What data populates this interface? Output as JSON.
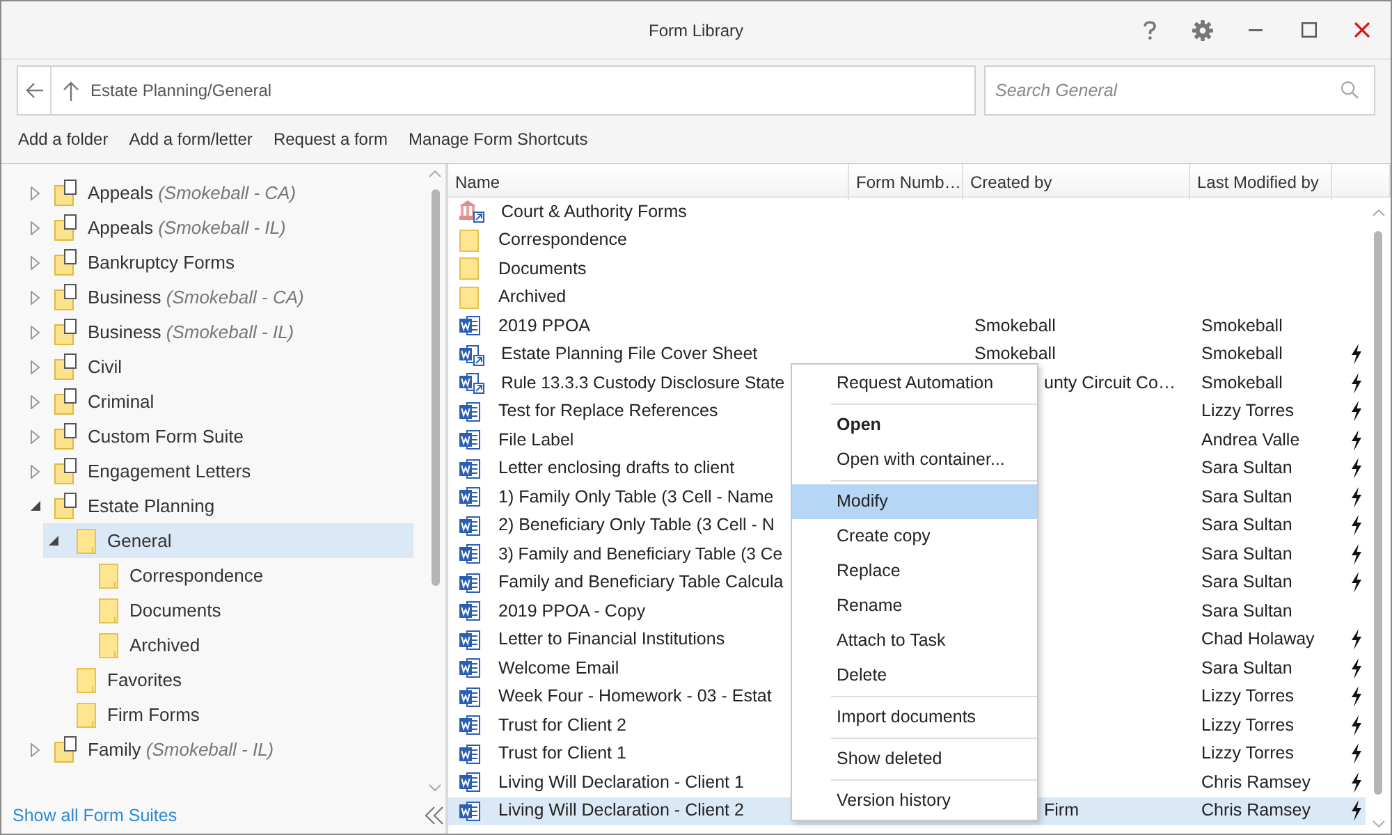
{
  "window": {
    "title": "Form Library"
  },
  "address": {
    "path": "Estate Planning/General"
  },
  "search": {
    "placeholder": "Search General"
  },
  "toolbar": [
    "Add a folder",
    "Add a form/letter",
    "Request a form",
    "Manage Form Shortcuts"
  ],
  "tree": [
    {
      "label": "Appeals *(Smokeball - CA)*",
      "kind": "suite",
      "expanded": false,
      "selected": false
    },
    {
      "label": "Appeals *(Smokeball - IL)*",
      "kind": "suite",
      "expanded": false,
      "selected": false
    },
    {
      "label": "Bankruptcy Forms",
      "kind": "suite",
      "expanded": false,
      "selected": false
    },
    {
      "label": "Business *(Smokeball - CA)*",
      "kind": "suite",
      "expanded": false,
      "selected": false
    },
    {
      "label": "Business *(Smokeball - IL)*",
      "kind": "suite",
      "expanded": false,
      "selected": false
    },
    {
      "label": "Civil",
      "kind": "suite",
      "expanded": false,
      "selected": false
    },
    {
      "label": "Criminal",
      "kind": "suite",
      "expanded": false,
      "selected": false
    },
    {
      "label": "Custom Form Suite",
      "kind": "suite",
      "expanded": false,
      "selected": false
    },
    {
      "label": "Engagement Letters",
      "kind": "suite",
      "expanded": false,
      "selected": false
    },
    {
      "label": "Estate Planning",
      "kind": "suite",
      "expanded": true,
      "selected": false,
      "children": [
        {
          "label": "General",
          "kind": "folder",
          "expanded": true,
          "selected": true,
          "children": [
            {
              "label": "Correspondence",
              "kind": "folder",
              "selected": false
            },
            {
              "label": "Documents",
              "kind": "folder",
              "selected": false
            },
            {
              "label": "Archived",
              "kind": "folder",
              "selected": false
            }
          ]
        },
        {
          "label": "Favorites",
          "kind": "folder",
          "selected": false
        },
        {
          "label": "Firm Forms",
          "kind": "folder",
          "selected": false
        }
      ]
    },
    {
      "label": "Family *(Smokeball - IL)*",
      "kind": "suite",
      "expanded": false,
      "selected": false
    }
  ],
  "show_all_link": "Show all Form Suites",
  "table": {
    "columns": [
      "Name",
      "Form Numb…",
      "Created by",
      "Last Modified by"
    ],
    "rows": [
      {
        "kind": "court-shortcut",
        "name": "Court & Authority Forms",
        "automated": false,
        "selected": false
      },
      {
        "kind": "folder",
        "name": "Correspondence",
        "automated": false,
        "selected": false
      },
      {
        "kind": "folder",
        "name": "Documents",
        "automated": false,
        "selected": false
      },
      {
        "kind": "folder",
        "name": "Archived",
        "automated": false,
        "selected": false
      },
      {
        "kind": "word",
        "name": "2019 PPOA",
        "created_by": "Smokeball",
        "modified_by": "Smokeball",
        "automated": false,
        "selected": false
      },
      {
        "kind": "word-shortcut",
        "name": "Estate Planning File Cover Sheet",
        "created_by": "Smokeball",
        "modified_by": "Smokeball",
        "automated": true,
        "selected": false
      },
      {
        "kind": "word-shortcut",
        "name": "Rule 13.3.3 Custody Disclosure State",
        "created_by": "unty Circuit Co…",
        "modified_by": "Smokeball",
        "automated": true,
        "selected": false
      },
      {
        "kind": "word",
        "name": "Test for Replace References",
        "modified_by": "Lizzy Torres",
        "automated": true,
        "selected": false
      },
      {
        "kind": "word",
        "name": "File Label",
        "modified_by": "Andrea Valle",
        "automated": true,
        "selected": false
      },
      {
        "kind": "word",
        "name": "Letter enclosing drafts to client",
        "modified_by": "Sara Sultan",
        "automated": true,
        "selected": false
      },
      {
        "kind": "word",
        "name": "1) Family Only Table (3 Cell - Name",
        "modified_by": "Sara Sultan",
        "automated": true,
        "selected": false
      },
      {
        "kind": "word",
        "name": "2) Beneficiary Only Table (3 Cell - N",
        "modified_by": "Sara Sultan",
        "automated": true,
        "selected": false
      },
      {
        "kind": "word",
        "name": "3) Family and Beneficiary Table (3 Ce",
        "modified_by": "Sara Sultan",
        "automated": true,
        "selected": false
      },
      {
        "kind": "word",
        "name": "Family and Beneficiary Table Calcula",
        "modified_by": "Sara Sultan",
        "automated": true,
        "selected": false
      },
      {
        "kind": "word",
        "name": "2019 PPOA - Copy",
        "modified_by": "Sara Sultan",
        "automated": false,
        "selected": false
      },
      {
        "kind": "word",
        "name": "Letter to Financial Institutions",
        "modified_by": "Chad Holaway",
        "automated": true,
        "selected": false
      },
      {
        "kind": "word",
        "name": "Welcome Email",
        "modified_by": "Sara Sultan",
        "automated": true,
        "selected": false
      },
      {
        "kind": "word",
        "name": "Week Four - Homework - 03 - Estat",
        "modified_by": "Lizzy Torres",
        "automated": true,
        "selected": false
      },
      {
        "kind": "word",
        "name": "Trust for Client 2",
        "modified_by": "Lizzy Torres",
        "automated": true,
        "selected": false
      },
      {
        "kind": "word",
        "name": "Trust for Client 1",
        "modified_by": "Lizzy Torres",
        "automated": true,
        "selected": false
      },
      {
        "kind": "word",
        "name": "Living Will Declaration - Client 1",
        "modified_by": "Chris Ramsey",
        "automated": true,
        "selected": false
      },
      {
        "kind": "word",
        "name": "Living Will Declaration - Client 2",
        "created_by": "Firm",
        "modified_by": "Chris Ramsey",
        "automated": true,
        "selected": true
      }
    ]
  },
  "context_menu": {
    "groups": [
      [
        {
          "label": "Request Automation",
          "default": false,
          "selected": false
        }
      ],
      [
        {
          "label": "Open",
          "default": true,
          "selected": false
        },
        {
          "label": "Open with container...",
          "default": false,
          "selected": false
        }
      ],
      [
        {
          "label": "Modify",
          "default": false,
          "selected": true
        },
        {
          "label": "Create copy",
          "default": false,
          "selected": false
        },
        {
          "label": "Replace",
          "default": false,
          "selected": false
        },
        {
          "label": "Rename",
          "default": false,
          "selected": false
        },
        {
          "label": "Attach to Task",
          "default": false,
          "selected": false
        },
        {
          "label": "Delete",
          "default": false,
          "selected": false
        }
      ],
      [
        {
          "label": "Import documents",
          "default": false,
          "selected": false
        }
      ],
      [
        {
          "label": "Show deleted",
          "default": false,
          "selected": false
        }
      ],
      [
        {
          "label": "Version history",
          "default": false,
          "selected": false
        }
      ]
    ]
  }
}
